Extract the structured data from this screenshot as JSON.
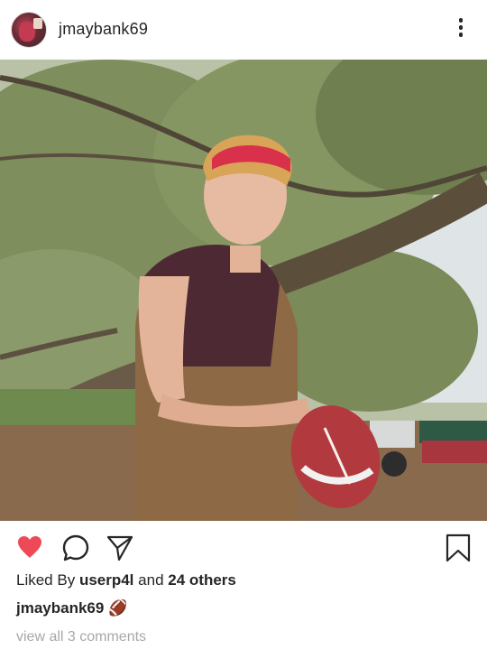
{
  "post": {
    "username": "jmaybank69"
  },
  "icons": {
    "more": "more-options-icon",
    "like": "heart-filled-icon",
    "comment": "comment-icon",
    "share": "direct-share-icon",
    "save": "bookmark-icon",
    "caption_emoji": "football-emoji"
  },
  "colors": {
    "like_red": "#ed4956",
    "text": "#262626",
    "muted": "#a8a8a8"
  },
  "likes": {
    "prefix": "Liked By",
    "user": "userp4l",
    "middle": "and",
    "others": "24 others"
  },
  "caption": {
    "username": "jmaybank69",
    "emoji": "🏈"
  },
  "comments": {
    "link_text": "view all 3 comments"
  }
}
